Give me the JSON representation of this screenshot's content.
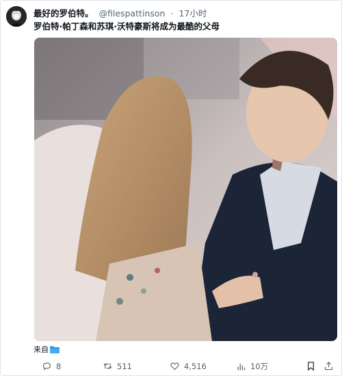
{
  "tweet": {
    "author_name": "最好的罗伯特。",
    "author_handle": "@filespattinson",
    "separator": "·",
    "time": "17小时",
    "text": "罗伯特·帕丁森和苏琪·沃特豪斯将成为最酷的父母",
    "source_label": "来自"
  },
  "actions": {
    "reply_count": "8",
    "retweet_count": "511",
    "like_count": "4,516",
    "view_count": "10万"
  },
  "icons": [
    "avatar",
    "folder-icon",
    "reply-icon",
    "retweet-icon",
    "like-icon",
    "views-icon",
    "bookmark-icon",
    "share-icon"
  ],
  "colors": {
    "text": "#0f1419",
    "secondary": "#536471",
    "folder": "#1d9bf0"
  }
}
